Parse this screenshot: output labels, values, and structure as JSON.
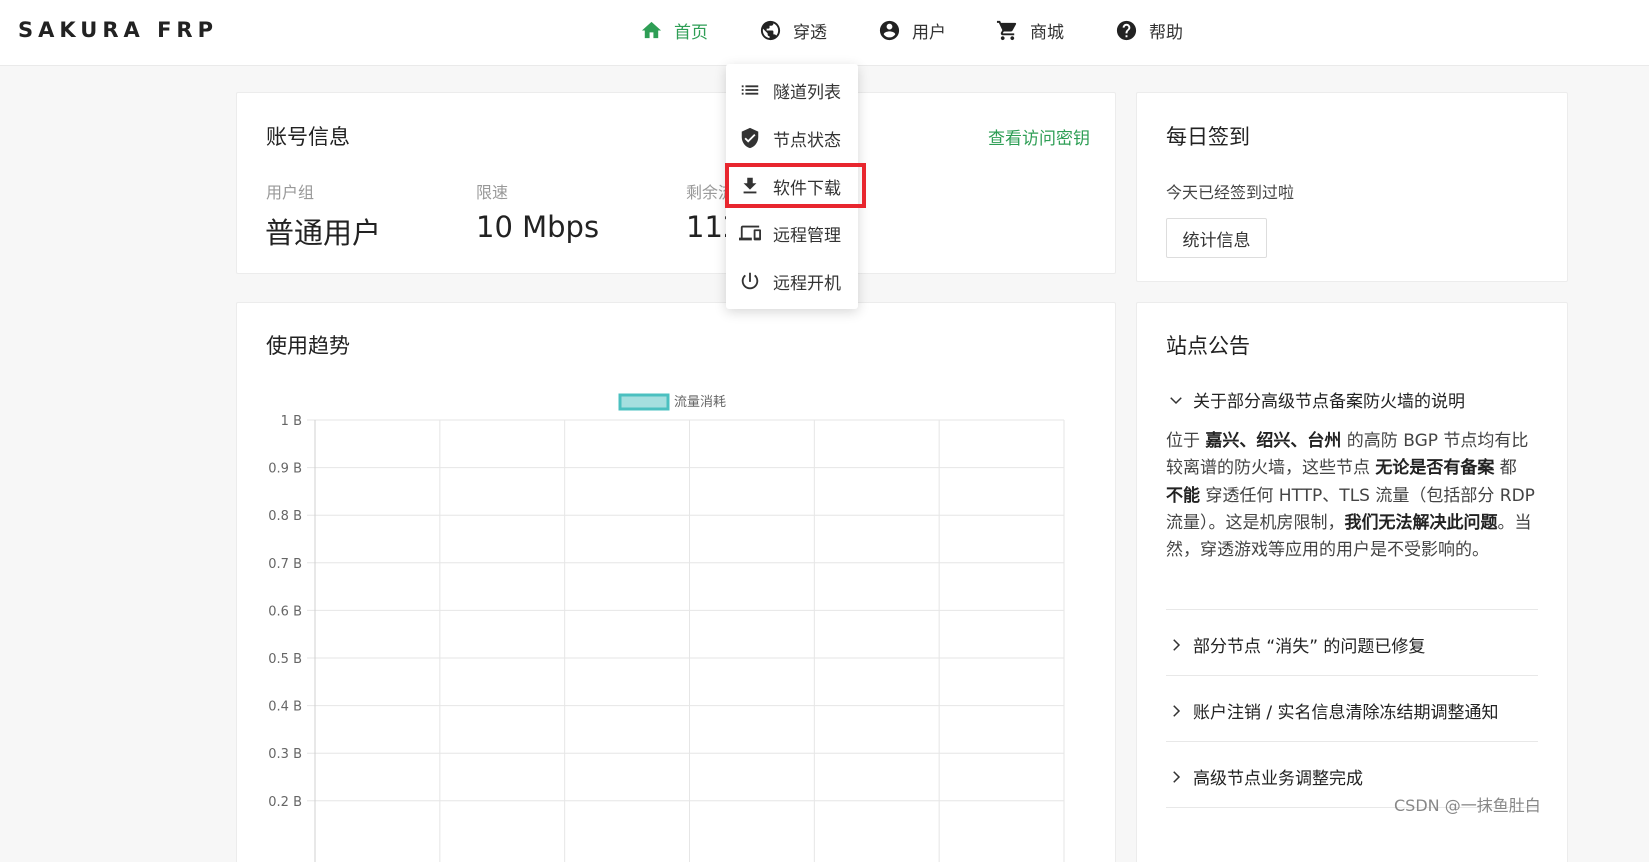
{
  "brand": "SAKURA FRP",
  "nav": {
    "home": "首页",
    "tunnel": "穿透",
    "user": "用户",
    "shop": "商城",
    "help": "帮助"
  },
  "dropdown": {
    "items": [
      "隧道列表",
      "节点状态",
      "软件下载",
      "远程管理",
      "远程开机"
    ],
    "highlight_color": "#e8262e"
  },
  "account": {
    "title": "账号信息",
    "access_key_link": "查看访问密钥",
    "group_label": "用户组",
    "group_value": "普通用户",
    "speed_label": "限速",
    "speed_value": "10 Mbps",
    "traffic_label": "剩余流",
    "traffic_value": "112"
  },
  "checkin": {
    "title": "每日签到",
    "status": "今天已经签到过啦",
    "stats_button": "统计信息"
  },
  "trend": {
    "title": "使用趋势"
  },
  "chart_data": {
    "type": "line",
    "legend": [
      "流量消耗"
    ],
    "series": [
      {
        "name": "流量消耗",
        "values": []
      }
    ],
    "y_ticks": [
      "1 B",
      "0.9 B",
      "0.8 B",
      "0.7 B",
      "0.6 B",
      "0.5 B",
      "0.4 B",
      "0.3 B",
      "0.2 B"
    ],
    "ylim": [
      0.2,
      1
    ],
    "grid": true,
    "legend_position": "top",
    "legend_color": "#4bc0c0",
    "legend_fill": "#a5dfdf"
  },
  "announcements": {
    "title": "站点公告",
    "items": [
      {
        "title": "关于部分高级节点备案防火墙的说明",
        "expanded": true,
        "body": [
          "位于 ",
          "嘉兴、绍兴、台州",
          " 的高防 BGP 节点均有比较离谱的防火墙，这些节点 ",
          "无论是否有备案",
          " 都 ",
          "不能",
          " 穿透任何 HTTP、TLS 流量（包括部分 RDP 流量）。这是机房限制，",
          "我们无法解决此问题",
          "。当然，穿透游戏等应用的用户是不受影响的。"
        ]
      },
      {
        "title": "部分节点 “消失” 的问题已修复",
        "expanded": false
      },
      {
        "title": "账户注销 / 实名信息清除冻结期调整通知",
        "expanded": false
      },
      {
        "title": "高级节点业务调整完成",
        "expanded": false
      }
    ]
  },
  "watermark": "CSDN @一抹鱼肚白",
  "accent_color": "#2e9e55"
}
